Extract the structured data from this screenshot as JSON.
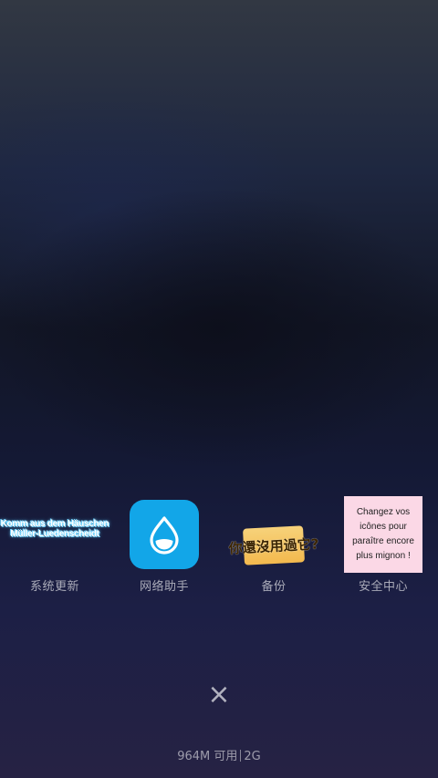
{
  "recent_apps": [
    {
      "name": "系统更新",
      "icon": "sticker-icon",
      "sticker_lines": [
        "Komm aus dem Häuschen",
        "Müller-Luedenscheidt"
      ]
    },
    {
      "name": "网络助手",
      "icon": "water-drop-icon",
      "accent": "#12a6e8"
    },
    {
      "name": "备份",
      "icon": "sticker-icon",
      "sticker_lines": [
        "你還沒用過它?"
      ]
    },
    {
      "name": "安全中心",
      "icon": "sticker-icon",
      "sticker_lines": [
        "Changez vos icônes pour",
        "paraître encore plus mignon !"
      ]
    }
  ],
  "close_label": "×",
  "memory": {
    "available": "964M 可用",
    "total": "2G"
  }
}
